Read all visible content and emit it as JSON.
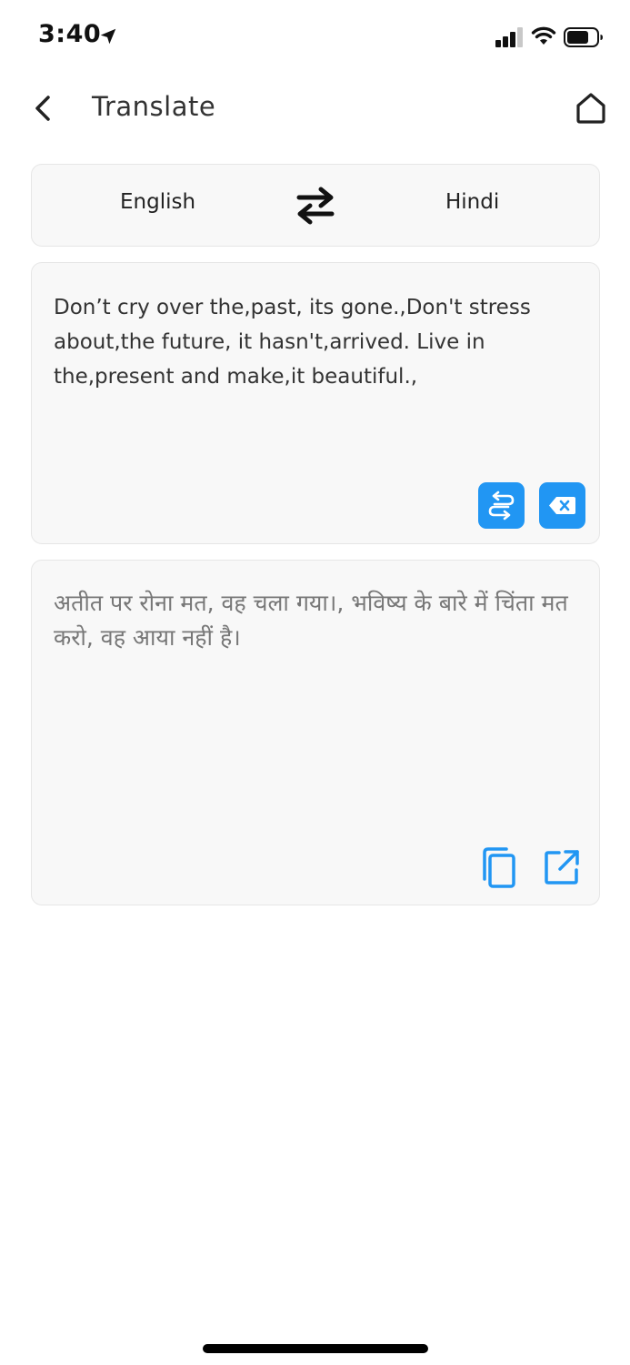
{
  "status_bar": {
    "time": "3:40",
    "icons": [
      "location-arrow-icon",
      "cellular-signal-icon",
      "wifi-icon",
      "battery-icon"
    ]
  },
  "header": {
    "title": "Translate",
    "back_icon": "chevron-left-icon",
    "home_icon": "home-icon"
  },
  "languages": {
    "source": "English",
    "target": "Hindi",
    "swap_icon": "swap-arrows-icon"
  },
  "input": {
    "text": "Don’t cry over the,past, its gone.,Don't stress about,the future, it hasn't,arrived. Live in the,present and make,it beautiful.,",
    "actions": [
      "translate-icon",
      "backspace-clear-icon"
    ]
  },
  "output": {
    "text": "अतीत पर रोना मत, वह चला गया।, भविष्य के बारे में चिंता मत करो, वह आया नहीं है।",
    "actions": [
      "copy-icon",
      "share-external-icon"
    ]
  },
  "colors": {
    "accent": "#2196f3",
    "card_bg": "#f8f8f8",
    "card_border": "#e6e6e6",
    "title_text": "#333333",
    "output_text": "#777777"
  }
}
